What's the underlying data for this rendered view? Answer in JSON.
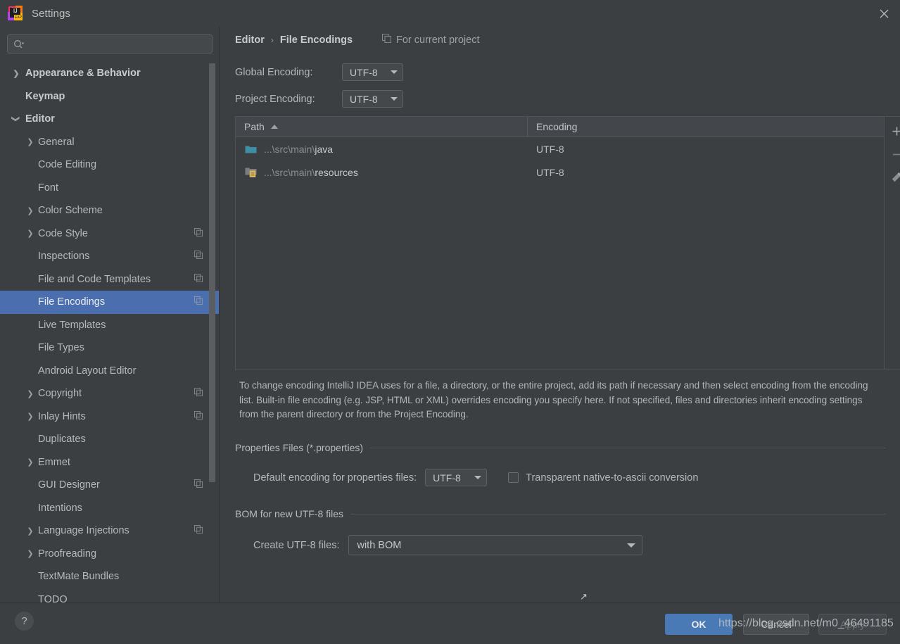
{
  "window": {
    "title": "Settings",
    "app_icon": "intellij-idea-eap-icon",
    "close_icon": "close-icon"
  },
  "search": {
    "value": "",
    "placeholder": "",
    "icon": "search-icon"
  },
  "sidebar": {
    "items": [
      {
        "label": "Appearance & Behavior",
        "indent": 0,
        "arrow": "chevron-right",
        "bold": true,
        "selected": false,
        "copy_icon": false
      },
      {
        "label": "Keymap",
        "indent": 0,
        "arrow": "none",
        "bold": true,
        "selected": false,
        "copy_icon": false
      },
      {
        "label": "Editor",
        "indent": 0,
        "arrow": "chevron-down",
        "bold": true,
        "selected": false,
        "copy_icon": false
      },
      {
        "label": "General",
        "indent": 1,
        "arrow": "chevron-right",
        "bold": false,
        "selected": false,
        "copy_icon": false
      },
      {
        "label": "Code Editing",
        "indent": 1,
        "arrow": "none",
        "bold": false,
        "selected": false,
        "copy_icon": false
      },
      {
        "label": "Font",
        "indent": 1,
        "arrow": "none",
        "bold": false,
        "selected": false,
        "copy_icon": false
      },
      {
        "label": "Color Scheme",
        "indent": 1,
        "arrow": "chevron-right",
        "bold": false,
        "selected": false,
        "copy_icon": false
      },
      {
        "label": "Code Style",
        "indent": 1,
        "arrow": "chevron-right",
        "bold": false,
        "selected": false,
        "copy_icon": true
      },
      {
        "label": "Inspections",
        "indent": 1,
        "arrow": "none",
        "bold": false,
        "selected": false,
        "copy_icon": true
      },
      {
        "label": "File and Code Templates",
        "indent": 1,
        "arrow": "none",
        "bold": false,
        "selected": false,
        "copy_icon": true
      },
      {
        "label": "File Encodings",
        "indent": 1,
        "arrow": "none",
        "bold": false,
        "selected": true,
        "copy_icon": true
      },
      {
        "label": "Live Templates",
        "indent": 1,
        "arrow": "none",
        "bold": false,
        "selected": false,
        "copy_icon": false
      },
      {
        "label": "File Types",
        "indent": 1,
        "arrow": "none",
        "bold": false,
        "selected": false,
        "copy_icon": false
      },
      {
        "label": "Android Layout Editor",
        "indent": 1,
        "arrow": "none",
        "bold": false,
        "selected": false,
        "copy_icon": false
      },
      {
        "label": "Copyright",
        "indent": 1,
        "arrow": "chevron-right",
        "bold": false,
        "selected": false,
        "copy_icon": true
      },
      {
        "label": "Inlay Hints",
        "indent": 1,
        "arrow": "chevron-right",
        "bold": false,
        "selected": false,
        "copy_icon": true
      },
      {
        "label": "Duplicates",
        "indent": 1,
        "arrow": "none",
        "bold": false,
        "selected": false,
        "copy_icon": false
      },
      {
        "label": "Emmet",
        "indent": 1,
        "arrow": "chevron-right",
        "bold": false,
        "selected": false,
        "copy_icon": false
      },
      {
        "label": "GUI Designer",
        "indent": 1,
        "arrow": "none",
        "bold": false,
        "selected": false,
        "copy_icon": true
      },
      {
        "label": "Intentions",
        "indent": 1,
        "arrow": "none",
        "bold": false,
        "selected": false,
        "copy_icon": false
      },
      {
        "label": "Language Injections",
        "indent": 1,
        "arrow": "chevron-right",
        "bold": false,
        "selected": false,
        "copy_icon": true
      },
      {
        "label": "Proofreading",
        "indent": 1,
        "arrow": "chevron-right",
        "bold": false,
        "selected": false,
        "copy_icon": false
      },
      {
        "label": "TextMate Bundles",
        "indent": 1,
        "arrow": "none",
        "bold": false,
        "selected": false,
        "copy_icon": false
      },
      {
        "label": "TODO",
        "indent": 1,
        "arrow": "none",
        "bold": false,
        "selected": false,
        "copy_icon": false
      }
    ]
  },
  "main": {
    "breadcrumb": {
      "parent": "Editor",
      "separator": "›",
      "current": "File Encodings",
      "scope_note": "For current project",
      "scope_icon": "copy-scope-icon"
    },
    "global_encoding": {
      "label": "Global Encoding:",
      "value": "UTF-8"
    },
    "project_encoding": {
      "label": "Project Encoding:",
      "value": "UTF-8"
    },
    "table": {
      "columns": [
        "Path",
        "Encoding"
      ],
      "sort_column": "Path",
      "sort_direction": "ascending",
      "rows": [
        {
          "path_prefix": "...\\src\\main\\",
          "path_name": "java",
          "icon": "folder-icon",
          "encoding": "UTF-8"
        },
        {
          "path_prefix": "...\\src\\main\\",
          "path_name": "resources",
          "icon": "folder-resources-icon",
          "encoding": "UTF-8"
        }
      ],
      "toolbar": [
        {
          "name": "add-path-button",
          "icon": "plus-icon"
        },
        {
          "name": "remove-path-button",
          "icon": "minus-icon"
        },
        {
          "name": "edit-path-button",
          "icon": "pencil-icon"
        }
      ]
    },
    "description": "To change encoding IntelliJ IDEA uses for a file, a directory, or the entire project, add its path if necessary and then select encoding from the encoding list. Built-in file encoding (e.g. JSP, HTML or XML) overrides encoding you specify here. If not specified, files and directories inherit encoding settings from the parent directory or from the Project Encoding.",
    "properties_group": {
      "title": "Properties Files (*.properties)",
      "default_encoding_label": "Default encoding for properties files:",
      "default_encoding_value": "UTF-8",
      "transparent_label": "Transparent native-to-ascii conversion",
      "transparent_checked": false
    },
    "bom_group": {
      "title": "BOM for new UTF-8 files",
      "create_label": "Create UTF-8 files:",
      "create_value": "with BOM"
    },
    "cursor": "↗"
  },
  "footer": {
    "help_label": "?",
    "ok_label": "OK",
    "cancel_label": "Cancel",
    "apply_label": "Apply",
    "watermark": "https://blog.csdn.net/m0_46491185"
  },
  "colors": {
    "window_bg": "#3c3f41",
    "selection": "#4b6eaf",
    "primary_button": "#4a7ab5",
    "folder_icon": "#3e8ea6",
    "text": "#b4b6b8"
  }
}
